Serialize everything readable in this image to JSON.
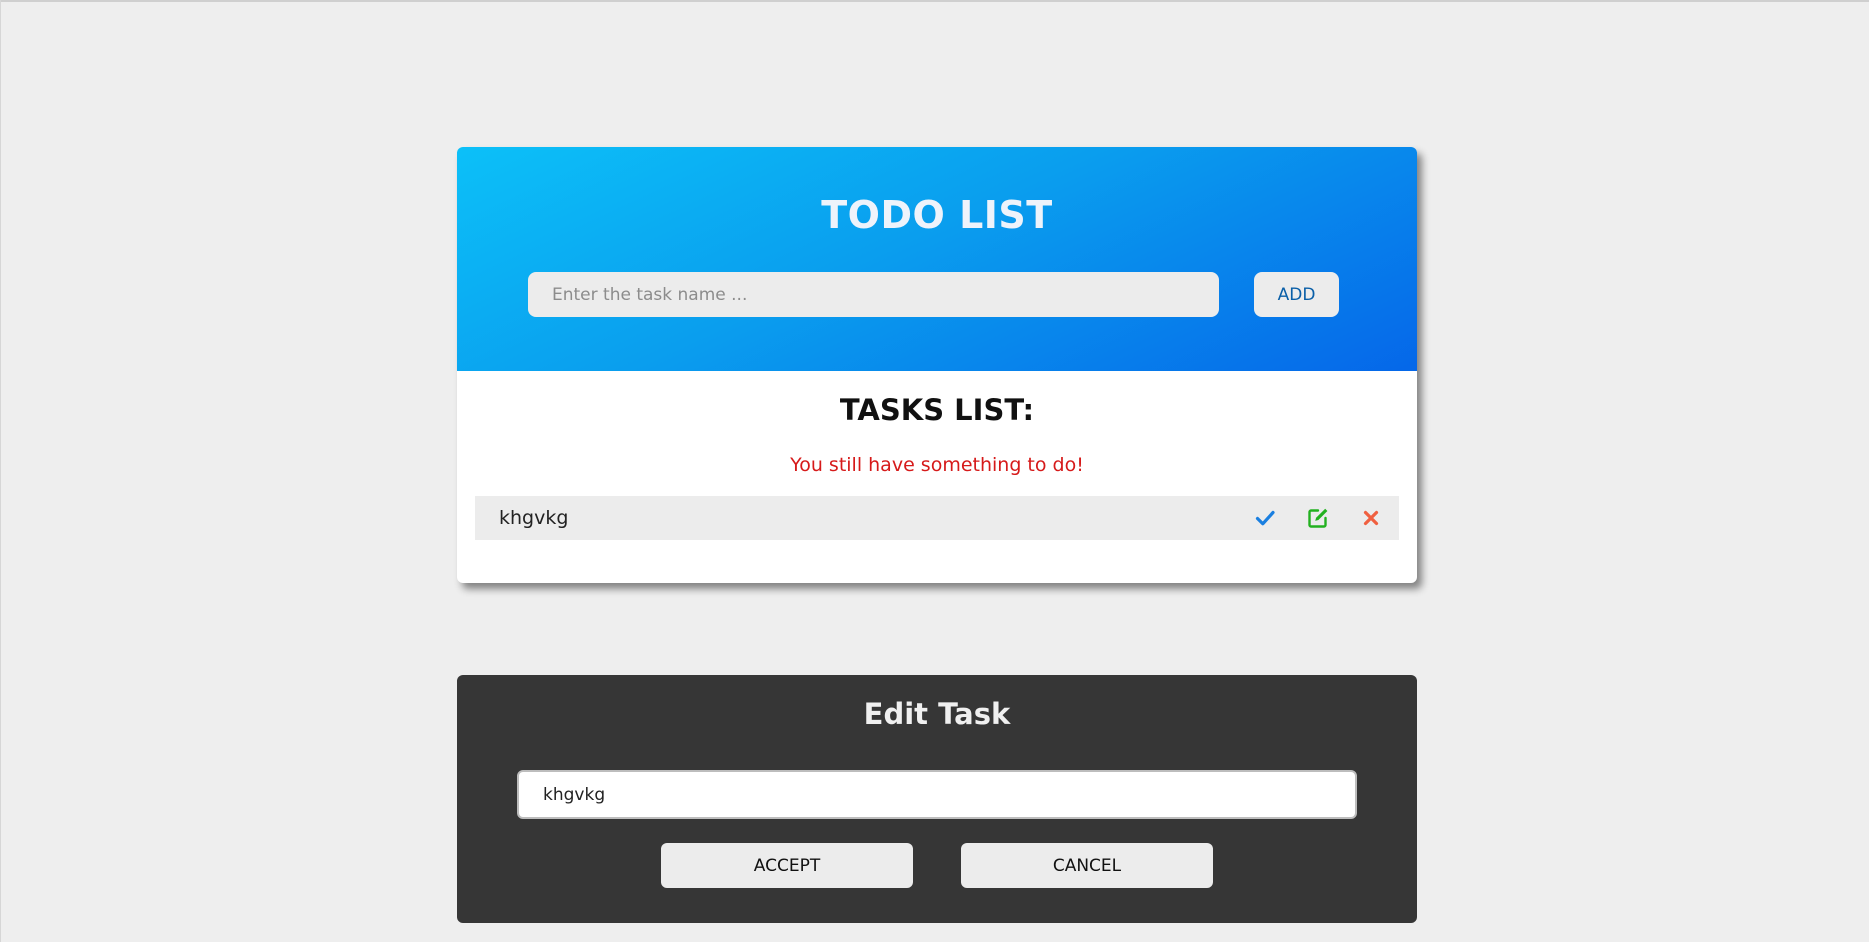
{
  "todo": {
    "title": "TODO LIST",
    "input_placeholder": "Enter the task name ...",
    "input_value": "",
    "add_label": "ADD"
  },
  "tasks": {
    "heading": "TASKS LIST:",
    "status_message": "You still have something to do!",
    "items": [
      {
        "name": "khgvkg",
        "actions": [
          {
            "icon": "check-icon",
            "color": "#1a7fe0"
          },
          {
            "icon": "edit-icon",
            "color": "#22b11f"
          },
          {
            "icon": "close-icon",
            "color": "#f06040"
          }
        ]
      }
    ]
  },
  "edit": {
    "title": "Edit Task",
    "input_value": "khgvkg",
    "accept_label": "ACCEPT",
    "cancel_label": "CANCEL"
  },
  "colors": {
    "page_background": "#eeeeee",
    "header_gradient_start": "#0cc0f8",
    "header_gradient_end": "#0567e9",
    "status_text": "#d61a1a",
    "edit_panel_background": "#363636"
  }
}
